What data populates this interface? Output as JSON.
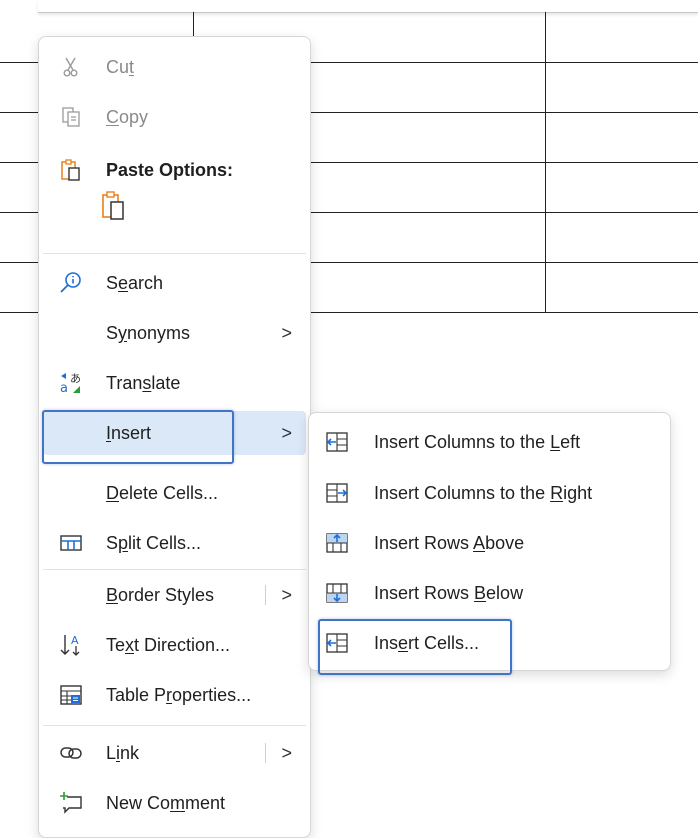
{
  "menu": {
    "cut": {
      "pre": "Cu",
      "key": "t",
      "post": ""
    },
    "copy": {
      "pre": "",
      "key": "C",
      "post": "opy"
    },
    "paste_options": {
      "label": "Paste Options:"
    },
    "search": {
      "pre": "S",
      "key": "e",
      "post": "arch"
    },
    "synonyms": {
      "pre": "S",
      "key": "y",
      "post": "nonyms"
    },
    "translate": {
      "pre": "Tran",
      "key": "s",
      "post": "late"
    },
    "insert": {
      "pre": "",
      "key": "I",
      "post": "nsert"
    },
    "delete_cells": {
      "pre": "",
      "key": "D",
      "post": "elete Cells..."
    },
    "split_cells": {
      "pre": "S",
      "key": "p",
      "post": "lit Cells..."
    },
    "border_styles": {
      "pre": "",
      "key": "B",
      "post": "order Styles"
    },
    "text_direction": {
      "pre": "Te",
      "key": "x",
      "post": "t Direction..."
    },
    "table_properties": {
      "pre": "Table P",
      "key": "r",
      "post": "operties..."
    },
    "link": {
      "pre": "L",
      "key": "i",
      "post": "nk"
    },
    "new_comment": {
      "pre": "New Co",
      "key": "m",
      "post": "ment"
    },
    "submenu_arrow": ">"
  },
  "submenu": {
    "insert_columns_left": {
      "pre": "Insert Columns to the ",
      "key": "L",
      "post": "eft"
    },
    "insert_columns_right": {
      "pre": "Insert Columns to the ",
      "key": "R",
      "post": "ight"
    },
    "insert_rows_above": {
      "pre": "Insert Rows ",
      "key": "A",
      "post": "bove"
    },
    "insert_rows_below": {
      "pre": "Insert Rows ",
      "key": "B",
      "post": "elow"
    },
    "insert_cells": {
      "pre": "Ins",
      "key": "e",
      "post": "rt Cells..."
    }
  },
  "colors": {
    "accent": "#4472c4",
    "selected_bg": "#dbe8f7",
    "paste_icon": "#e8821e",
    "search_icon": "#1e6fd9",
    "disabled_text": "#8a8a8a"
  },
  "icons": {
    "cut": "scissors-icon",
    "copy": "copy-icon",
    "paste": "clipboard-icon",
    "search": "search-icon",
    "translate": "translate-icon",
    "split": "split-cells-icon",
    "text_direction": "text-direction-icon",
    "table_properties": "table-properties-icon",
    "link": "link-icon",
    "comment": "new-comment-icon"
  }
}
